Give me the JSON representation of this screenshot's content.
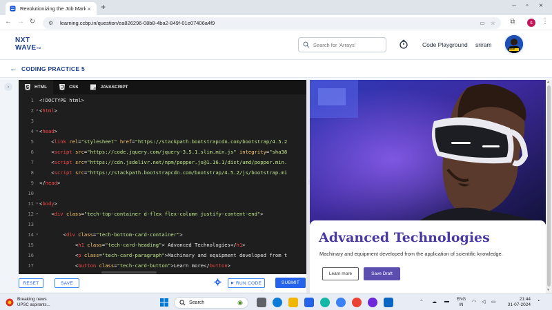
{
  "browser": {
    "tab_title": "Revolutionizing the Job Market",
    "url": "learning.ccbp.in/question/ea826296-08b8-4ba2-849f-01e07406a4f9",
    "profile_initial": "s"
  },
  "header": {
    "logo_line1": "NXT",
    "logo_line2": "WAVE",
    "logo_tm": "TM",
    "search_placeholder": "Search for 'Arrays'",
    "playground_label": "Code Playground",
    "username": "sriram",
    "avatar_tag": "SRIRAM"
  },
  "page": {
    "title": "CODING PRACTICE 5"
  },
  "editor": {
    "tabs": [
      {
        "label": "HTML",
        "active": true
      },
      {
        "label": "CSS",
        "active": false
      },
      {
        "label": "JAVASCRIPT",
        "active": false
      }
    ],
    "lines": [
      {
        "n": "1",
        "fold": "",
        "parts": [
          [
            "dt",
            "<!DOCTYPE html>"
          ]
        ]
      },
      {
        "n": "2",
        "fold": "▾",
        "parts": [
          [
            "dt",
            "<"
          ],
          [
            "tag",
            "html"
          ],
          [
            "dt",
            ">"
          ]
        ]
      },
      {
        "n": "3",
        "fold": "",
        "parts": []
      },
      {
        "n": "4",
        "fold": "▾",
        "parts": [
          [
            "dt",
            "<"
          ],
          [
            "tag",
            "head"
          ],
          [
            "dt",
            ">"
          ]
        ]
      },
      {
        "n": "5",
        "fold": "",
        "parts": [
          [
            "dt",
            "    <"
          ],
          [
            "tag",
            "link"
          ],
          [
            "dt",
            " "
          ],
          [
            "attr",
            "rel"
          ],
          [
            "dt",
            "="
          ],
          [
            "str",
            "\"stylesheet\""
          ],
          [
            "dt",
            " "
          ],
          [
            "attr",
            "href"
          ],
          [
            "dt",
            "="
          ],
          [
            "str",
            "\"https://stackpath.bootstrapcdn.com/bootstrap/4.5.2"
          ]
        ]
      },
      {
        "n": "6",
        "fold": "",
        "parts": [
          [
            "dt",
            "    <"
          ],
          [
            "tag",
            "script"
          ],
          [
            "dt",
            " "
          ],
          [
            "attr",
            "src"
          ],
          [
            "dt",
            "="
          ],
          [
            "str",
            "\"https://code.jquery.com/jquery-3.5.1.slim.min.js\""
          ],
          [
            "dt",
            " "
          ],
          [
            "attr",
            "integrity"
          ],
          [
            "dt",
            "="
          ],
          [
            "str",
            "\"sha38"
          ]
        ]
      },
      {
        "n": "7",
        "fold": "",
        "parts": [
          [
            "dt",
            "    <"
          ],
          [
            "tag",
            "script"
          ],
          [
            "dt",
            " "
          ],
          [
            "attr",
            "src"
          ],
          [
            "dt",
            "="
          ],
          [
            "str",
            "\"https://cdn.jsdelivr.net/npm/popper.js@1.16.1/dist/umd/popper.min."
          ]
        ]
      },
      {
        "n": "8",
        "fold": "",
        "parts": [
          [
            "dt",
            "    <"
          ],
          [
            "tag",
            "script"
          ],
          [
            "dt",
            " "
          ],
          [
            "attr",
            "src"
          ],
          [
            "dt",
            "="
          ],
          [
            "str",
            "\"https://stackpath.bootstrapcdn.com/bootstrap/4.5.2/js/bootstrap.mi"
          ]
        ]
      },
      {
        "n": "9",
        "fold": "",
        "parts": [
          [
            "dt",
            "</"
          ],
          [
            "tag",
            "head"
          ],
          [
            "dt",
            ">"
          ]
        ]
      },
      {
        "n": "10",
        "fold": "",
        "parts": []
      },
      {
        "n": "11",
        "fold": "▾",
        "parts": [
          [
            "dt",
            "<"
          ],
          [
            "tag",
            "body"
          ],
          [
            "dt",
            ">"
          ]
        ]
      },
      {
        "n": "12",
        "fold": "▾",
        "parts": [
          [
            "dt",
            "    <"
          ],
          [
            "tag",
            "div"
          ],
          [
            "dt",
            " "
          ],
          [
            "attr",
            "class"
          ],
          [
            "dt",
            "="
          ],
          [
            "str",
            "\"tech-top-container d-flex flex-column justify-content-end\""
          ],
          [
            "dt",
            ">"
          ]
        ]
      },
      {
        "n": "13",
        "fold": "",
        "parts": []
      },
      {
        "n": "14",
        "fold": "▾",
        "parts": [
          [
            "dt",
            "        <"
          ],
          [
            "tag",
            "div"
          ],
          [
            "dt",
            " "
          ],
          [
            "attr",
            "class"
          ],
          [
            "dt",
            "="
          ],
          [
            "str",
            "\"tech-bottom-card-container\""
          ],
          [
            "dt",
            ">"
          ]
        ]
      },
      {
        "n": "15",
        "fold": "",
        "parts": [
          [
            "dt",
            "            <"
          ],
          [
            "tag",
            "h1"
          ],
          [
            "dt",
            " "
          ],
          [
            "attr",
            "class"
          ],
          [
            "dt",
            "="
          ],
          [
            "str",
            "\"tech-card-heading\""
          ],
          [
            "dt",
            "> Advanced Technologies</"
          ],
          [
            "tag",
            "h1"
          ],
          [
            "dt",
            ">"
          ]
        ]
      },
      {
        "n": "16",
        "fold": "",
        "parts": [
          [
            "dt",
            "            <"
          ],
          [
            "tag",
            "p"
          ],
          [
            "dt",
            " "
          ],
          [
            "attr",
            "class"
          ],
          [
            "dt",
            "="
          ],
          [
            "str",
            "\"tech-card-paragraph\""
          ],
          [
            "dt",
            ">Machinary and equipment developed from t"
          ]
        ]
      },
      {
        "n": "17",
        "fold": "",
        "parts": [
          [
            "dt",
            "            <"
          ],
          [
            "tag",
            "button"
          ],
          [
            "dt",
            " "
          ],
          [
            "attr",
            "class"
          ],
          [
            "dt",
            "="
          ],
          [
            "str",
            "\"tech-card-button\""
          ],
          [
            "dt",
            ">Learn more</"
          ],
          [
            "tag",
            "button"
          ],
          [
            "dt",
            ">"
          ]
        ]
      }
    ]
  },
  "actions": {
    "reset": "RESET",
    "save": "SAVE",
    "run": "RUN CODE",
    "submit": "SUBMIT"
  },
  "preview": {
    "heading": "Advanced Technologies",
    "paragraph": "Machinary and equipment developed from the application of scientific knowledge.",
    "learn_more": "Learn more",
    "save_draft": "Save Draft"
  },
  "taskbar": {
    "news_title": "Breaking news",
    "news_sub": "UPSC aspirants...",
    "search_label": "Search",
    "lang1": "ENG",
    "lang2": "IN",
    "time": "21:44",
    "date": "31-07-2024"
  }
}
